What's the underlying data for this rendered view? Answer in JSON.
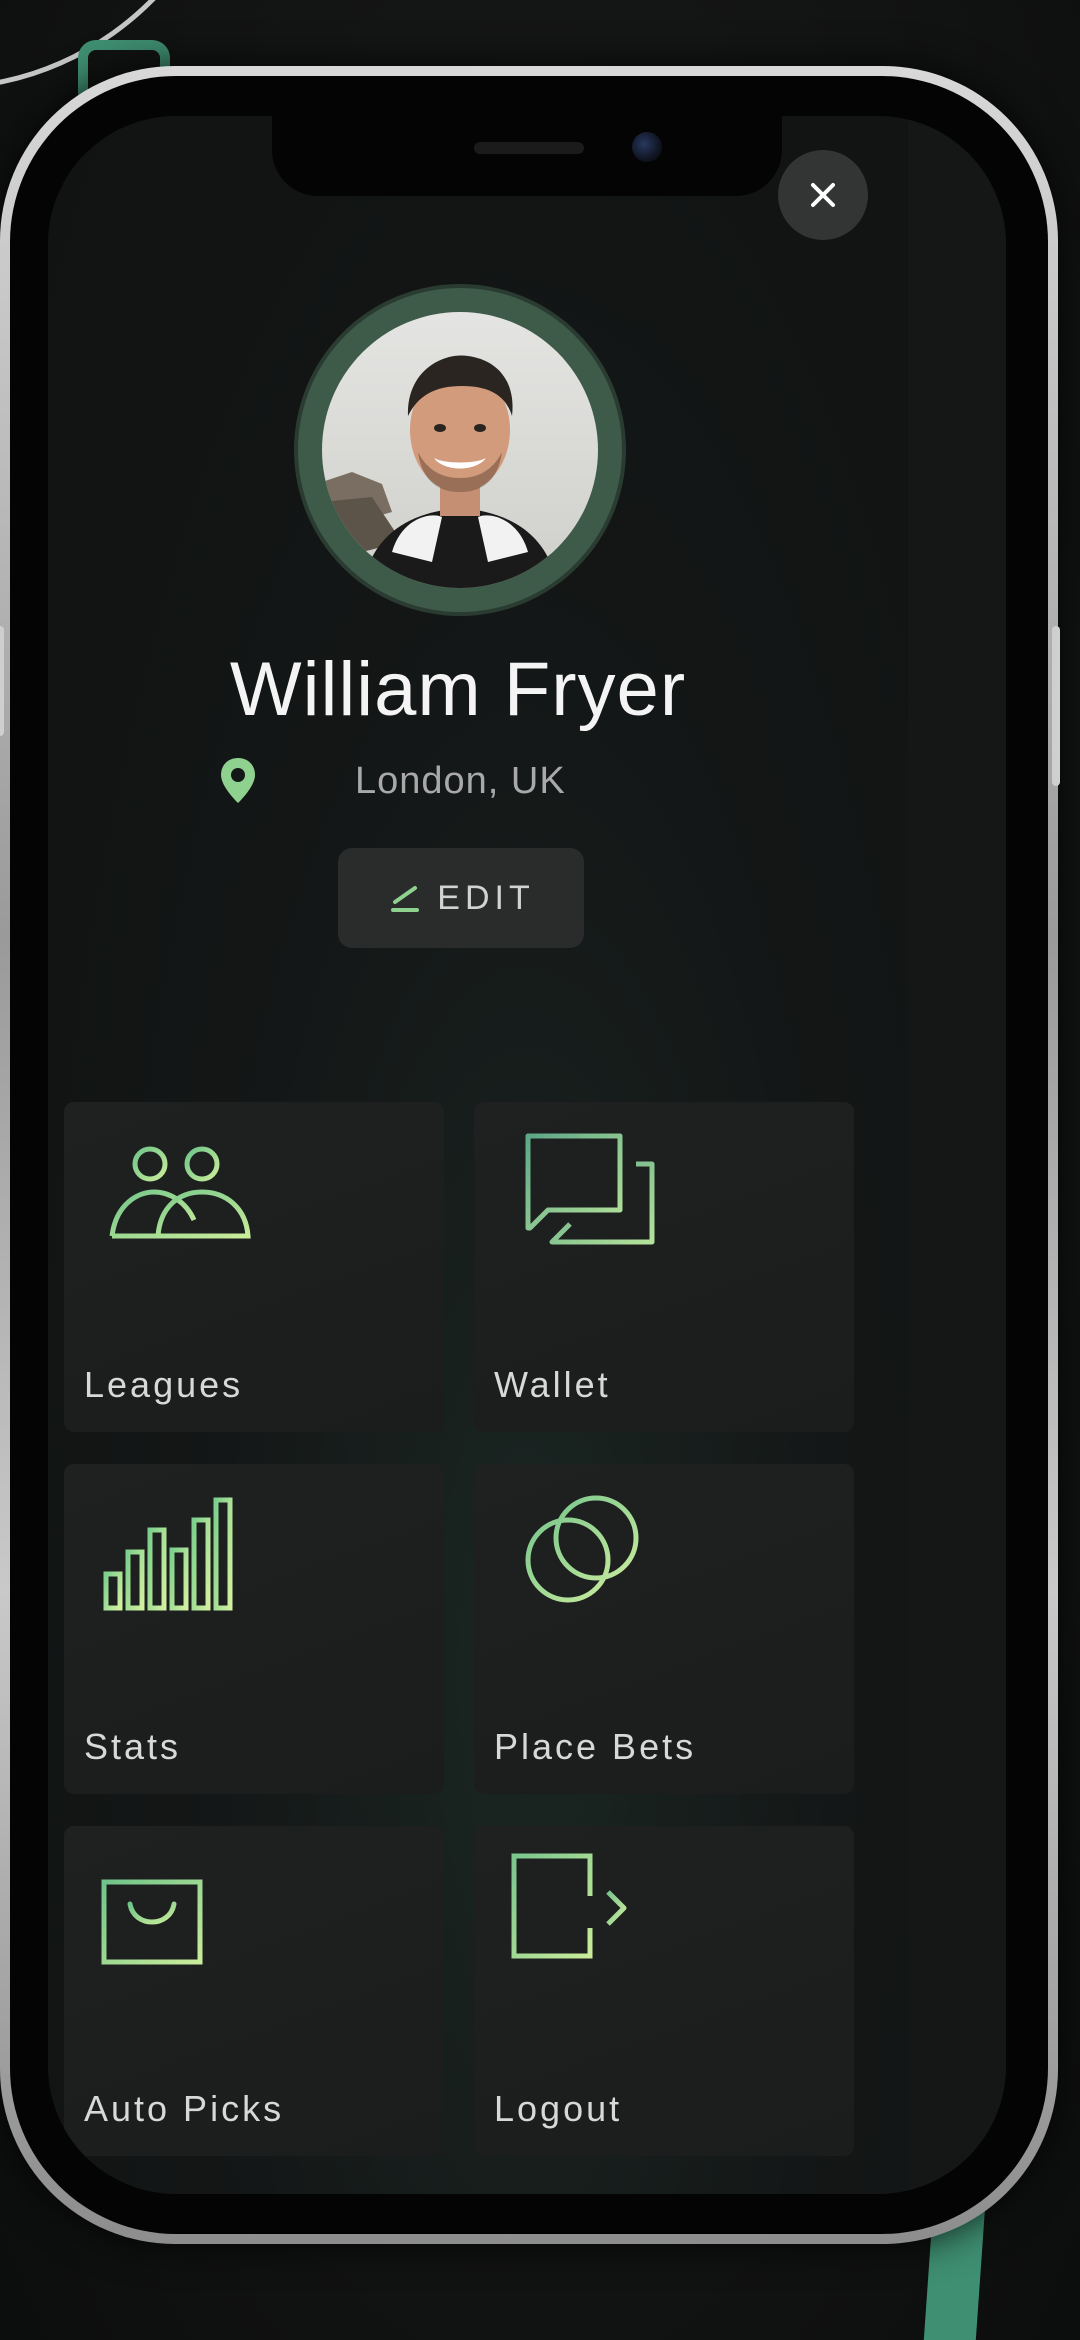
{
  "profile": {
    "name": "William Fryer",
    "location": "London, UK",
    "edit_label": "EDIT"
  },
  "close_label": "×",
  "menu": [
    {
      "label": "Leagues",
      "icon": "users-icon"
    },
    {
      "label": "Wallet",
      "icon": "chat-bubbles-icon"
    },
    {
      "label": "Stats",
      "icon": "bar-chart-icon"
    },
    {
      "label": "Place Bets",
      "icon": "rings-icon"
    },
    {
      "label": "Auto Picks",
      "icon": "shopping-bag-icon"
    },
    {
      "label": "Logout",
      "icon": "logout-icon"
    }
  ],
  "colors": {
    "accent": "#9ad89a",
    "tile_bg": "#1e2020",
    "text": "#f4f4f4"
  }
}
